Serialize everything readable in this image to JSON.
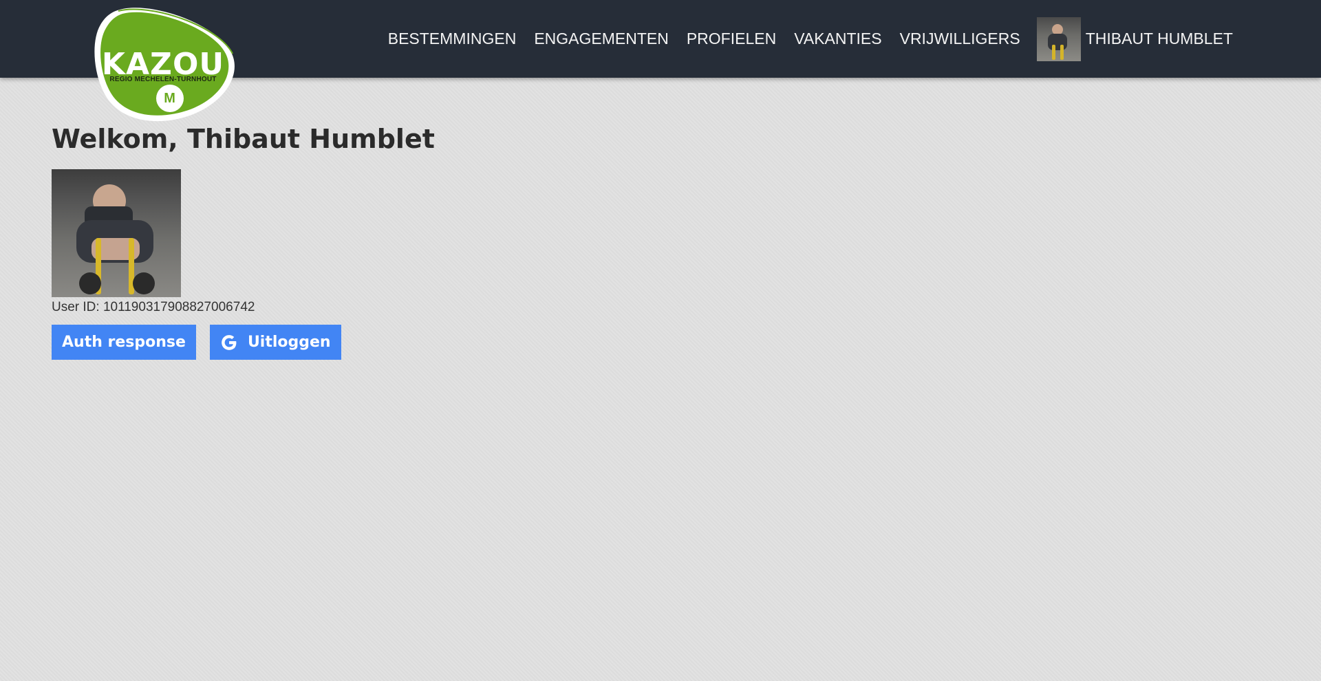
{
  "brand": {
    "name": "KAZOU",
    "region": "REGIO MECHELEN-TURNHOUT",
    "badge_mark": "M",
    "colors": {
      "green": "#6aaa1f",
      "dark": "#262d38",
      "button": "#4285f4"
    }
  },
  "nav": {
    "items": [
      {
        "label": "BESTEMMINGEN"
      },
      {
        "label": "ENGAGEMENTEN"
      },
      {
        "label": "PROFIELEN"
      },
      {
        "label": "VAKANTIES"
      },
      {
        "label": "VRIJWILLIGERS"
      }
    ],
    "user_name": "THIBAUT HUMBLET"
  },
  "main": {
    "welcome": "Welkom, Thibaut Humblet",
    "user_id": "User ID: 101190317908827006742",
    "buttons": {
      "auth": "Auth response",
      "logout": "Uitloggen"
    }
  },
  "icons": {
    "logout": "google-icon"
  }
}
